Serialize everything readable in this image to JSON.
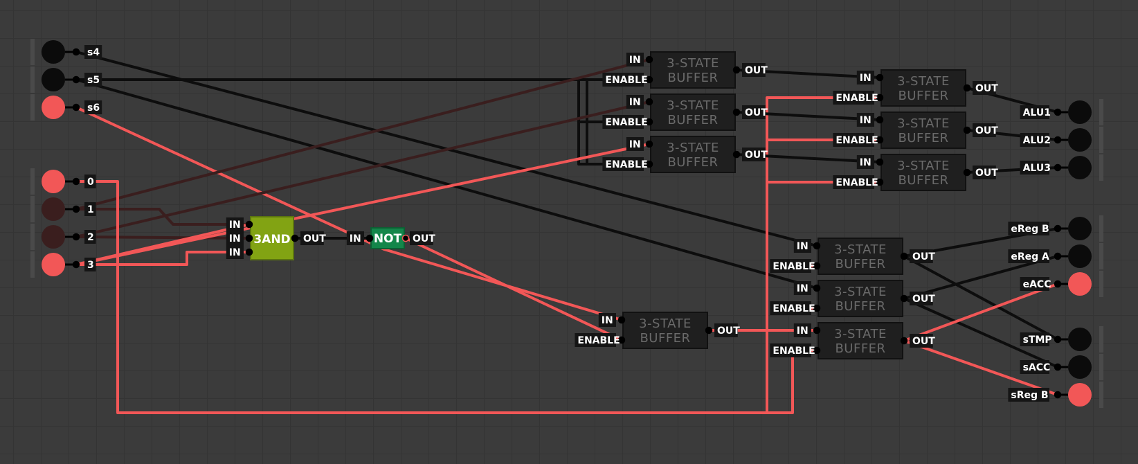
{
  "colors": {
    "background": "#3b3b3b",
    "grid": "#343434",
    "wire_on": "#f25757",
    "wire_off": "#0d0d0d",
    "wire_dim": "#3a1e1e",
    "node_on": "#f25757",
    "node_off": "#0b0b0b",
    "node_dim": "#3a1e1e",
    "buffer_body": "#1f1f1f",
    "and_gate": "#82a313",
    "not_gate": "#13864a"
  },
  "inputs": [
    {
      "label": "s4",
      "state": "off"
    },
    {
      "label": "s5",
      "state": "off"
    },
    {
      "label": "s6",
      "state": "on"
    },
    {
      "label": "0",
      "state": "on"
    },
    {
      "label": "1",
      "state": "dim"
    },
    {
      "label": "2",
      "state": "dim"
    },
    {
      "label": "3",
      "state": "on"
    }
  ],
  "outputs": [
    {
      "label": "ALU1",
      "state": "off"
    },
    {
      "label": "ALU2",
      "state": "off"
    },
    {
      "label": "ALU3",
      "state": "off"
    },
    {
      "label": "eReg B",
      "state": "off"
    },
    {
      "label": "eReg A",
      "state": "off"
    },
    {
      "label": "eACC",
      "state": "on"
    },
    {
      "label": "sTMP",
      "state": "off"
    },
    {
      "label": "sACC",
      "state": "off"
    },
    {
      "label": "sReg B",
      "state": "on"
    }
  ],
  "gates": {
    "and3": {
      "label": "3AND",
      "input_labels": [
        "IN",
        "IN",
        "IN"
      ],
      "output_label": "OUT"
    },
    "not": {
      "label": "NOT",
      "input_label": "IN",
      "output_label": "OUT"
    }
  },
  "buffer": {
    "label_line1": "3-STATE",
    "label_line2": "BUFFER",
    "in_label": "IN",
    "enable_label": "ENABLE",
    "out_label": "OUT",
    "count": 10
  }
}
